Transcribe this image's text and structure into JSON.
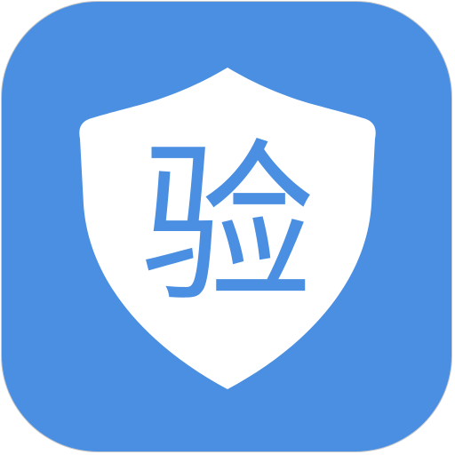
{
  "app_icon": {
    "glyph": "验",
    "icon": "shield-icon",
    "colors": {
      "background": "#4a8fe2",
      "shield": "#ffffff",
      "glyph": "#4a8fe2",
      "border": "#c9c9c9"
    }
  }
}
